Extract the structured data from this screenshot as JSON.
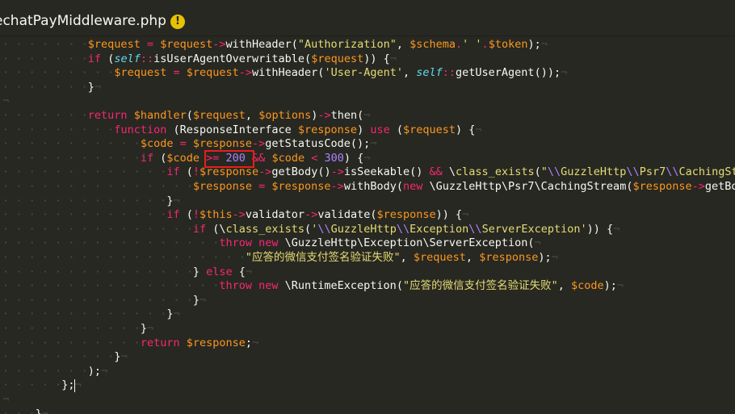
{
  "tab": {
    "title": "echatPayMiddleware.php",
    "warning_icon": "!"
  },
  "code": {
    "lines": [
      {
        "ind": 7,
        "tokens": [
          [
            "va",
            "$request"
          ],
          [
            "op",
            " = "
          ],
          [
            "va",
            "$request"
          ],
          [
            "op",
            "->"
          ],
          [
            "pl",
            "withHeader("
          ],
          [
            "st",
            "\"Authorization\""
          ],
          [
            "pl",
            ", "
          ],
          [
            "va",
            "$schema"
          ],
          [
            "op",
            "."
          ],
          [
            "st",
            "' '"
          ],
          [
            "op",
            "."
          ],
          [
            "va",
            "$token"
          ],
          [
            "pl",
            ");"
          ]
        ]
      },
      {
        "ind": 7,
        "tokens": [
          [
            "kw",
            "if"
          ],
          [
            "pl",
            " ("
          ],
          [
            "se",
            "self"
          ],
          [
            "op",
            "::"
          ],
          [
            "pl",
            "isUserAgentOverwritable("
          ],
          [
            "va",
            "$request"
          ],
          [
            "pl",
            ")) {"
          ]
        ]
      },
      {
        "ind": 9,
        "tokens": [
          [
            "va",
            "$request"
          ],
          [
            "op",
            " = "
          ],
          [
            "va",
            "$request"
          ],
          [
            "op",
            "->"
          ],
          [
            "pl",
            "withHeader("
          ],
          [
            "st",
            "'User-Agent'"
          ],
          [
            "pl",
            ", "
          ],
          [
            "se",
            "self"
          ],
          [
            "op",
            "::"
          ],
          [
            "pl",
            "getUserAgent());"
          ]
        ]
      },
      {
        "ind": 7,
        "tokens": [
          [
            "pl",
            "}"
          ]
        ]
      },
      {
        "ind": 0,
        "tokens": []
      },
      {
        "ind": 7,
        "tokens": [
          [
            "kw",
            "return"
          ],
          [
            "pl",
            " "
          ],
          [
            "va",
            "$handler"
          ],
          [
            "pl",
            "("
          ],
          [
            "va",
            "$request"
          ],
          [
            "pl",
            ", "
          ],
          [
            "va",
            "$options"
          ],
          [
            "pl",
            ")"
          ],
          [
            "op",
            "->"
          ],
          [
            "pl",
            "then("
          ]
        ]
      },
      {
        "ind": 9,
        "tokens": [
          [
            "kw",
            "function"
          ],
          [
            "pl",
            " (ResponseInterface "
          ],
          [
            "va",
            "$response"
          ],
          [
            "pl",
            ") "
          ],
          [
            "kw",
            "use"
          ],
          [
            "pl",
            " ("
          ],
          [
            "va",
            "$request"
          ],
          [
            "pl",
            ") {"
          ]
        ]
      },
      {
        "ind": 11,
        "tokens": [
          [
            "va",
            "$code"
          ],
          [
            "op",
            " = "
          ],
          [
            "va",
            "$response"
          ],
          [
            "op",
            "->"
          ],
          [
            "pl",
            "getStatusCode();"
          ]
        ]
      },
      {
        "ind": 11,
        "tokens": [
          [
            "kw",
            "if"
          ],
          [
            "pl",
            " ("
          ],
          [
            "va",
            "$code"
          ],
          [
            "op",
            " >= "
          ],
          [
            "nu",
            "200"
          ],
          [
            "pl",
            " "
          ],
          [
            "op",
            "&&"
          ],
          [
            "pl",
            " "
          ],
          [
            "va",
            "$code"
          ],
          [
            "op",
            " < "
          ],
          [
            "nu",
            "300"
          ],
          [
            "pl",
            ") {"
          ]
        ]
      },
      {
        "ind": 13,
        "tokens": [
          [
            "kw",
            "if"
          ],
          [
            "pl",
            " ("
          ],
          [
            "op",
            "!"
          ],
          [
            "va",
            "$response"
          ],
          [
            "op",
            "->"
          ],
          [
            "pl",
            "getBody()"
          ],
          [
            "op",
            "->"
          ],
          [
            "pl",
            "isSeekable() "
          ],
          [
            "op",
            "&&"
          ],
          [
            "pl",
            " \\"
          ],
          [
            "fn",
            "class_exists"
          ],
          [
            "pl",
            "("
          ],
          [
            "st",
            "\""
          ],
          [
            "sl",
            "\\\\"
          ],
          [
            "st",
            "GuzzleHttp"
          ],
          [
            "sl",
            "\\\\"
          ],
          [
            "st",
            "Psr7"
          ],
          [
            "sl",
            "\\\\"
          ],
          [
            "st",
            "CachingStream\""
          ],
          [
            "pl",
            ")) {"
          ]
        ]
      },
      {
        "ind": 15,
        "tokens": [
          [
            "va",
            "$response"
          ],
          [
            "op",
            " = "
          ],
          [
            "va",
            "$response"
          ],
          [
            "op",
            "->"
          ],
          [
            "pl",
            "withBody("
          ],
          [
            "kw",
            "new"
          ],
          [
            "pl",
            " \\GuzzleHttp\\Psr7\\CachingStream("
          ],
          [
            "va",
            "$response"
          ],
          [
            "op",
            "->"
          ],
          [
            "pl",
            "getBody()));"
          ]
        ]
      },
      {
        "ind": 13,
        "tokens": [
          [
            "pl",
            "}"
          ]
        ]
      },
      {
        "ind": 13,
        "tokens": [
          [
            "kw",
            "if"
          ],
          [
            "pl",
            " ("
          ],
          [
            "op",
            "!"
          ],
          [
            "va",
            "$this"
          ],
          [
            "op",
            "->"
          ],
          [
            "pl",
            "validator"
          ],
          [
            "op",
            "->"
          ],
          [
            "pl",
            "validate("
          ],
          [
            "va",
            "$response"
          ],
          [
            "pl",
            ")) {"
          ]
        ]
      },
      {
        "ind": 15,
        "tokens": [
          [
            "kw",
            "if"
          ],
          [
            "pl",
            " (\\"
          ],
          [
            "fn",
            "class_exists"
          ],
          [
            "pl",
            "("
          ],
          [
            "st",
            "'"
          ],
          [
            "sl",
            "\\\\"
          ],
          [
            "st",
            "GuzzleHttp"
          ],
          [
            "sl",
            "\\\\"
          ],
          [
            "st",
            "Exception"
          ],
          [
            "sl",
            "\\\\"
          ],
          [
            "st",
            "ServerException'"
          ],
          [
            "pl",
            ")) {"
          ]
        ]
      },
      {
        "ind": 17,
        "tokens": [
          [
            "kw",
            "throw"
          ],
          [
            "pl",
            " "
          ],
          [
            "kw",
            "new"
          ],
          [
            "pl",
            " \\GuzzleHttp\\Exception\\ServerException("
          ]
        ]
      },
      {
        "ind": 19,
        "tokens": [
          [
            "st",
            "\"应答的微信支付签名验证失败\""
          ],
          [
            "pl",
            ", "
          ],
          [
            "va",
            "$request"
          ],
          [
            "pl",
            ", "
          ],
          [
            "va",
            "$response"
          ],
          [
            "pl",
            ");"
          ]
        ]
      },
      {
        "ind": 15,
        "tokens": [
          [
            "pl",
            "} "
          ],
          [
            "kw",
            "else"
          ],
          [
            "pl",
            " {"
          ]
        ]
      },
      {
        "ind": 17,
        "tokens": [
          [
            "kw",
            "throw"
          ],
          [
            "pl",
            " "
          ],
          [
            "kw",
            "new"
          ],
          [
            "pl",
            " \\RuntimeException("
          ],
          [
            "st",
            "\"应答的微信支付签名验证失败\""
          ],
          [
            "pl",
            ", "
          ],
          [
            "va",
            "$code"
          ],
          [
            "pl",
            ");"
          ]
        ]
      },
      {
        "ind": 15,
        "tokens": [
          [
            "pl",
            "}"
          ]
        ]
      },
      {
        "ind": 13,
        "tokens": [
          [
            "pl",
            "}"
          ]
        ]
      },
      {
        "ind": 11,
        "tokens": [
          [
            "pl",
            "}"
          ]
        ]
      },
      {
        "ind": 11,
        "tokens": [
          [
            "kw",
            "return"
          ],
          [
            "pl",
            " "
          ],
          [
            "va",
            "$response"
          ],
          [
            "pl",
            ";"
          ]
        ]
      },
      {
        "ind": 9,
        "tokens": [
          [
            "pl",
            "}"
          ]
        ]
      },
      {
        "ind": 7,
        "tokens": [
          [
            "pl",
            ");"
          ]
        ]
      },
      {
        "ind": 5,
        "tokens": [
          [
            "pl",
            "};"
          ]
        ]
      },
      {
        "ind": 0,
        "tokens": []
      },
      {
        "ind": 3,
        "tokens": [
          [
            "pl",
            "}"
          ]
        ]
      }
    ]
  }
}
